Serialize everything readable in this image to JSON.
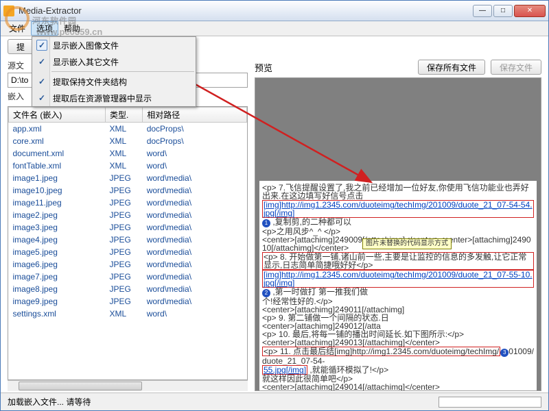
{
  "window": {
    "title": "Media-Extractor"
  },
  "menubar": {
    "file": "文件",
    "options": "选项",
    "help": "帮助"
  },
  "dropdown": {
    "show_images": "显示嵌入图像文件",
    "show_other": "显示嵌入其它文件",
    "keep_structure": "提取保持文件夹结构",
    "show_in_explorer": "提取后在资源管理器中显示"
  },
  "toolbar": {
    "extract_selected": "提"
  },
  "labels": {
    "source_file": "源文",
    "path_value": "D:\\to",
    "embedded": "嵌入"
  },
  "table": {
    "col_name": "文件名 (嵌入)",
    "col_type": "类型.",
    "col_relpath": "相对路径",
    "rows": [
      {
        "name": "app.xml",
        "type": "XML",
        "path": "docProps\\"
      },
      {
        "name": "core.xml",
        "type": "XML",
        "path": "docProps\\"
      },
      {
        "name": "document.xml",
        "type": "XML",
        "path": "word\\"
      },
      {
        "name": "fontTable.xml",
        "type": "XML",
        "path": "word\\"
      },
      {
        "name": "image1.jpeg",
        "type": "JPEG",
        "path": "word\\media\\"
      },
      {
        "name": "image10.jpeg",
        "type": "JPEG",
        "path": "word\\media\\"
      },
      {
        "name": "image11.jpeg",
        "type": "JPEG",
        "path": "word\\media\\"
      },
      {
        "name": "image2.jpeg",
        "type": "JPEG",
        "path": "word\\media\\"
      },
      {
        "name": "image3.jpeg",
        "type": "JPEG",
        "path": "word\\media\\"
      },
      {
        "name": "image4.jpeg",
        "type": "JPEG",
        "path": "word\\media\\"
      },
      {
        "name": "image5.jpeg",
        "type": "JPEG",
        "path": "word\\media\\"
      },
      {
        "name": "image6.jpeg",
        "type": "JPEG",
        "path": "word\\media\\"
      },
      {
        "name": "image7.jpeg",
        "type": "JPEG",
        "path": "word\\media\\"
      },
      {
        "name": "image8.jpeg",
        "type": "JPEG",
        "path": "word\\media\\"
      },
      {
        "name": "image9.jpeg",
        "type": "JPEG",
        "path": "word\\media\\"
      },
      {
        "name": "settings.xml",
        "type": "XML",
        "path": "word\\"
      }
    ]
  },
  "preview": {
    "title": "预览",
    "save_all": "保存所有文件",
    "save_file": "保存文件",
    "tooltip": "图片未替换的代码显示方式",
    "lines": {
      "l1": "<p> 7.飞信提醒设置了,我之前已经增加一位好友,你使用飞信功能业也弄好出来.在这边填写好信号点击",
      "url1": "[img]http://img1.2345.com/duoteimg/techImg/201009/duote_21_07-54-54.jpg[/img]",
      "l1b": ",复制剪,的二种都可以",
      "l2": "<p>之用风步^_^ </p>",
      "l3": "<center>[attachimg]249009[/attachimg]</center><center>[attachimg]249010[/attachimg]</center>",
      "l4": "<p> 8. 开始做第一铺,诸山前一些,主要是让监控的信息的多发触,让它正常显示,日志简单简捷哦好好</p>",
      "url2": "[img]http://img1.2345.com/duoteimg/techImg/201009/duote_21_07-55-10.jpg[/img]",
      "l4b": ",第一时做打 第一推我们做",
      "l5": "个!经常性好的.</p>",
      "l6": "<center>[attachimg]249011[/attachimg]",
      "l7": "<p> 9. 第二铺做一个间隔的状态.日",
      "l8": "<center>[attachimg]249012[/atta",
      "l9": "<p> 10. 最后,将每一铺的播出时间延长.如下图所示:</p>",
      "l10": "<center>[attachimg]249013[/attachimg]</center>",
      "l11a": "<p> 11. 点击最后结[img]http://img1.2345.com/duoteimg/techImg/",
      "l11b": "01009/duote_21_07-54-",
      "l11c": "55.jpg[/img]",
      "l11d": ",就能循环模拟了!</p>",
      "l12": "就这样因此很简单吧</p>",
      "l13": "<center>[attachimg]249014[/attachimg]</center>"
    }
  },
  "status": {
    "loading": "加载嵌入文件... 请等待"
  },
  "watermark": {
    "text": "河东软件园",
    "url": "www.pc0359.cn"
  }
}
